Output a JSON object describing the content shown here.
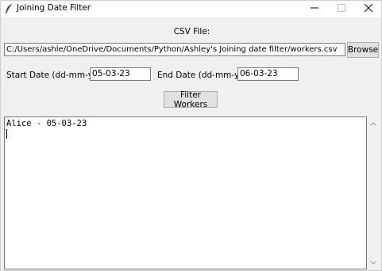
{
  "window": {
    "title": "Joining Date Filter"
  },
  "csv": {
    "label": "CSV File:",
    "path": "C:/Users/ashle/OneDrive/Documents/Python/Ashley's Joining date filter/workers.csv",
    "browse_label": "Browse"
  },
  "dates": {
    "start_label": "Start Date (dd-mm-yy):",
    "start_value": "05-03-23",
    "end_label": "End Date (dd-mm-yy):",
    "end_value": "06-03-23"
  },
  "filter": {
    "button_label": "Filter Workers"
  },
  "output": {
    "lines": [
      "Alice - 05-03-23"
    ]
  },
  "icons": {
    "app": "feather-icon",
    "minimize": "minimize-icon",
    "maximize": "maximize-icon",
    "close": "close-icon",
    "scroll_up": "chevron-up-icon",
    "scroll_down": "chevron-down-icon"
  }
}
